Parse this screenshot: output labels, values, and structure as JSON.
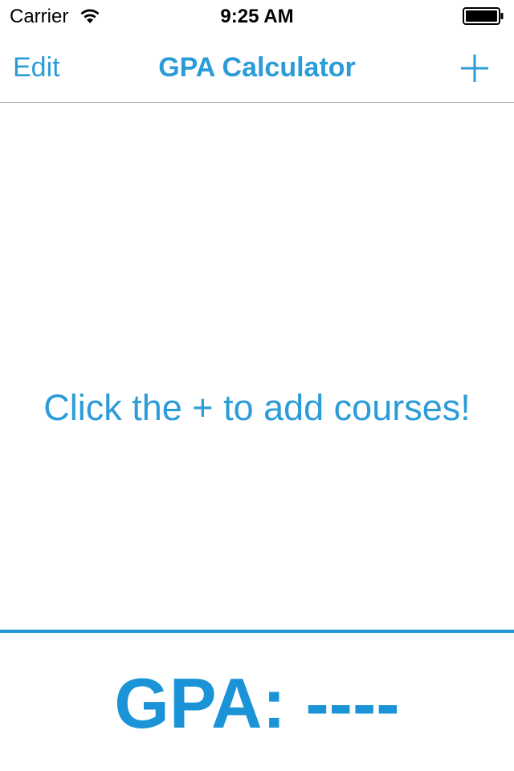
{
  "status_bar": {
    "carrier": "Carrier",
    "time": "9:25 AM",
    "wifi_icon": "wifi-icon",
    "battery_icon": "battery-icon"
  },
  "nav_bar": {
    "edit_label": "Edit",
    "title": "GPA Calculator",
    "add_icon": "plus-icon"
  },
  "main": {
    "empty_message": "Click the + to add courses!"
  },
  "footer": {
    "gpa_text": "GPA: ----"
  },
  "colors": {
    "accent": "#2b9cd8",
    "gpa": "#1a94d6",
    "divider": "#2196d6",
    "nav_separator": "#b2b2b2"
  }
}
